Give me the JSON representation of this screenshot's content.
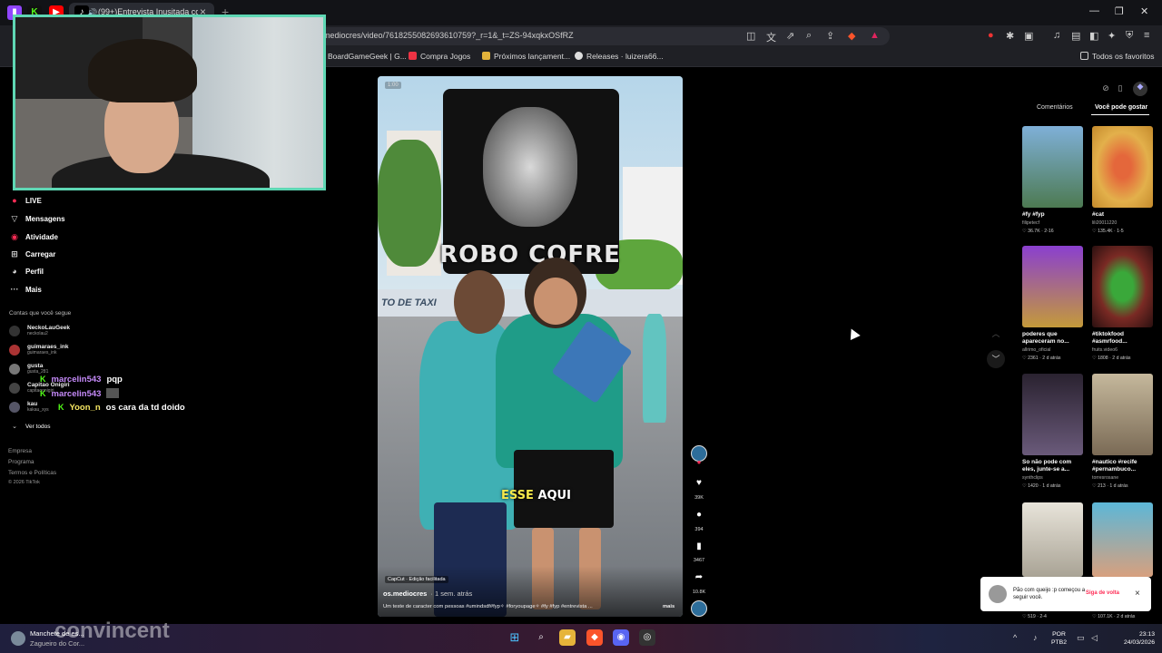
{
  "browser": {
    "active_tab_title": "(99+)Entrevista Inusitada co...",
    "url": "mediocres/video/7618255082693610759?_r=1&_t=ZS-94xqkxOSfRZ",
    "bookmarks": [
      "BoardGameGeek | G...",
      "Compra Jogos",
      "Próximos lançament...",
      "Releases · luizera66..."
    ],
    "favorites_label": "Todos os favoritos"
  },
  "sidebar": {
    "items": [
      {
        "icon": "live-icon",
        "label": "LIVE"
      },
      {
        "icon": "messages-icon",
        "label": "Mensagens"
      },
      {
        "icon": "activity-icon",
        "label": "Atividade"
      },
      {
        "icon": "upload-icon",
        "label": "Carregar"
      },
      {
        "icon": "profile-icon",
        "label": "Perfil"
      },
      {
        "icon": "more-icon",
        "label": "Mais"
      }
    ],
    "following_title": "Contas que você segue",
    "accounts": [
      {
        "name": "NeckoLauGeek",
        "handle": "neckolau2"
      },
      {
        "name": "guimaraes_ink",
        "handle": "guimaraes_ink"
      },
      {
        "name": "gusta",
        "handle": "gusta_281"
      },
      {
        "name": "Capitao Onigiri",
        "handle": "capitaoonigiri"
      },
      {
        "name": "kau",
        "handle": "kakau_xys"
      }
    ],
    "see_all": "Ver todos",
    "footer": [
      "Empresa",
      "Programa",
      "Termos e Políticas",
      "© 2026 TikTok"
    ]
  },
  "chat": [
    {
      "user": "marcelin543",
      "message": "pqp"
    },
    {
      "user": "marcelin543",
      "message": ""
    },
    {
      "user": "Yoon_n",
      "message": "os cara da td doido"
    }
  ],
  "video": {
    "time": "1:00",
    "meme_text": "ROBO COFRE",
    "sign_text": "TO DE TAXI",
    "caption_yellow": "ESSE",
    "caption_white": "AQUI",
    "capcut_label": "CapCut · Edição facilitada",
    "author": "os.mediocres",
    "posted": "· 1 sem. atrás",
    "description": "Um teste de caracter com pessoas #umindsdf#fyp✧ #foryoupage✧ #fy #fyp #entrevista ...",
    "more": "mais",
    "likes": "39K",
    "comments": "394",
    "saves": "3467",
    "shares": "10.8K"
  },
  "right_panel": {
    "tabs": [
      "Comentários",
      "Você pode gostar"
    ],
    "cards": [
      {
        "title": "#fy #fyp",
        "author": "filipetecf",
        "meta": "♡ 36.7K · 2-16",
        "color": "#6a9cc0"
      },
      {
        "title": "#cat",
        "author": "lili20011220",
        "meta": "♡ 135.4K · 1-5",
        "color": "#e0a23a"
      },
      {
        "title": "poderes que apareceram no...",
        "author": "allrimo_oficial",
        "meta": "♡ 2361 · 2 d atrás",
        "color": "#7b3fb5"
      },
      {
        "title": "#tiktokfood #asmrfood...",
        "author": "fruits.video6",
        "meta": "♡ 1808 · 2 d atrás",
        "color": "#7a2a24"
      },
      {
        "title": "So não pode com eles, junte-se a...",
        "author": "synthclips",
        "meta": "♡ 1420 · 1 d atrás",
        "color": "#4a3c4a"
      },
      {
        "title": "#nautico #recife #pernambuco...",
        "author": "torresrosane",
        "meta": "♡ 213 · 1 d atrás",
        "color": "#8a8370"
      },
      {
        "title": "",
        "author": "",
        "meta": "♡ 519 · 2-4",
        "color": "#c9c4b8"
      },
      {
        "title": "",
        "author": "",
        "meta": "♡ 107.1K · 2 d atrás",
        "color": "#56a7c6"
      }
    ]
  },
  "toast": {
    "text": "Pão com queijo :p começou a seguir você.",
    "button": "Siga de volta"
  },
  "taskbar": {
    "news_title": "Manchete de es...",
    "news_sub": "Zagueiro do Cor...",
    "watermark": "convincent",
    "lang_line1": "POR",
    "lang_line2": "PTB2",
    "time": "23:13",
    "date": "24/03/2026"
  }
}
